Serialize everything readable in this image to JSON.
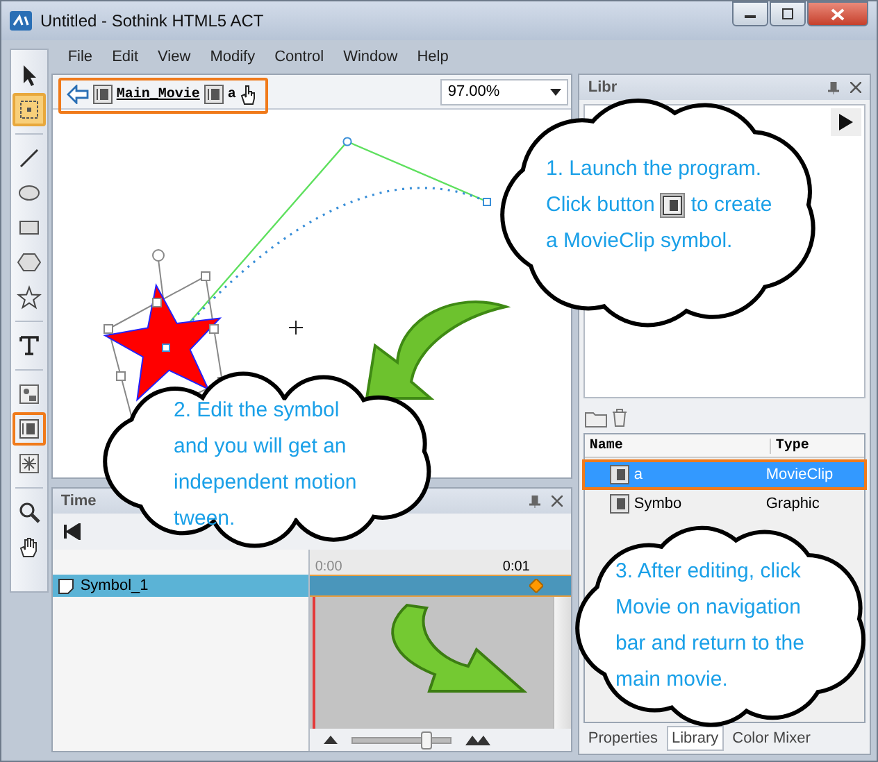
{
  "window": {
    "title": "Untitled - Sothink HTML5 ACT"
  },
  "menu": [
    "File",
    "Edit",
    "View",
    "Modify",
    "Control",
    "Window",
    "Help"
  ],
  "tool_groups": [
    [
      {
        "kind": "arrow",
        "selected": false,
        "highlighted": false
      },
      {
        "kind": "transform",
        "selected": true,
        "highlighted": false
      }
    ],
    [
      {
        "kind": "line",
        "selected": false,
        "highlighted": false
      },
      {
        "kind": "ellipse",
        "selected": false,
        "highlighted": false
      },
      {
        "kind": "rect",
        "selected": false,
        "highlighted": false
      },
      {
        "kind": "polygon",
        "selected": false,
        "highlighted": false
      },
      {
        "kind": "star",
        "selected": false,
        "highlighted": false
      }
    ],
    [
      {
        "kind": "text",
        "selected": false,
        "highlighted": false
      }
    ],
    [
      {
        "kind": "image",
        "selected": false,
        "highlighted": false
      },
      {
        "kind": "movieclip",
        "selected": false,
        "highlighted": true
      },
      {
        "kind": "particle",
        "selected": false,
        "highlighted": false
      }
    ],
    [
      {
        "kind": "zoom",
        "selected": false,
        "highlighted": false
      },
      {
        "kind": "hand",
        "selected": false,
        "highlighted": false
      }
    ]
  ],
  "navigation": {
    "highlighted": true,
    "crumbs": [
      {
        "label": "Main_Movie",
        "kind": "link"
      },
      {
        "label": "a",
        "kind": "current"
      }
    ],
    "zoom": "97.00%"
  },
  "library": {
    "title": "Libr",
    "columns": [
      "Name",
      "Type"
    ],
    "rows": [
      {
        "name": "a",
        "type": "MovieClip",
        "selected": true,
        "highlighted": true
      },
      {
        "name": "Symbo",
        "type": "Graphic",
        "selected": false,
        "highlighted": false
      }
    ],
    "tabs": [
      {
        "label": "Properties",
        "selected": false
      },
      {
        "label": "Library",
        "selected": true
      },
      {
        "label": "Color Mixer",
        "selected": false
      }
    ]
  },
  "timeline": {
    "title": "Time",
    "layers": [
      {
        "name": "Symbol_1",
        "selected": true
      }
    ],
    "ticks": [
      "0:00",
      "0:01"
    ],
    "zoom": {
      "level": 0.75
    }
  },
  "callouts": [
    {
      "parts": [
        {
          "kind": "text",
          "text": "1. Launch the program."
        },
        {
          "kind": "text",
          "text": "Click button"
        },
        {
          "kind": "icon"
        },
        {
          "kind": "text",
          "text": "to create"
        },
        {
          "kind": "text",
          "text": "a MovieClip symbol."
        }
      ]
    },
    {
      "parts": [
        {
          "kind": "text",
          "text": "2. Edit the symbol and you will get an independent motion tween."
        }
      ]
    },
    {
      "parts": [
        {
          "kind": "text",
          "text": "3. After editing, click Movie on navigation bar and return to the main movie."
        }
      ]
    }
  ]
}
